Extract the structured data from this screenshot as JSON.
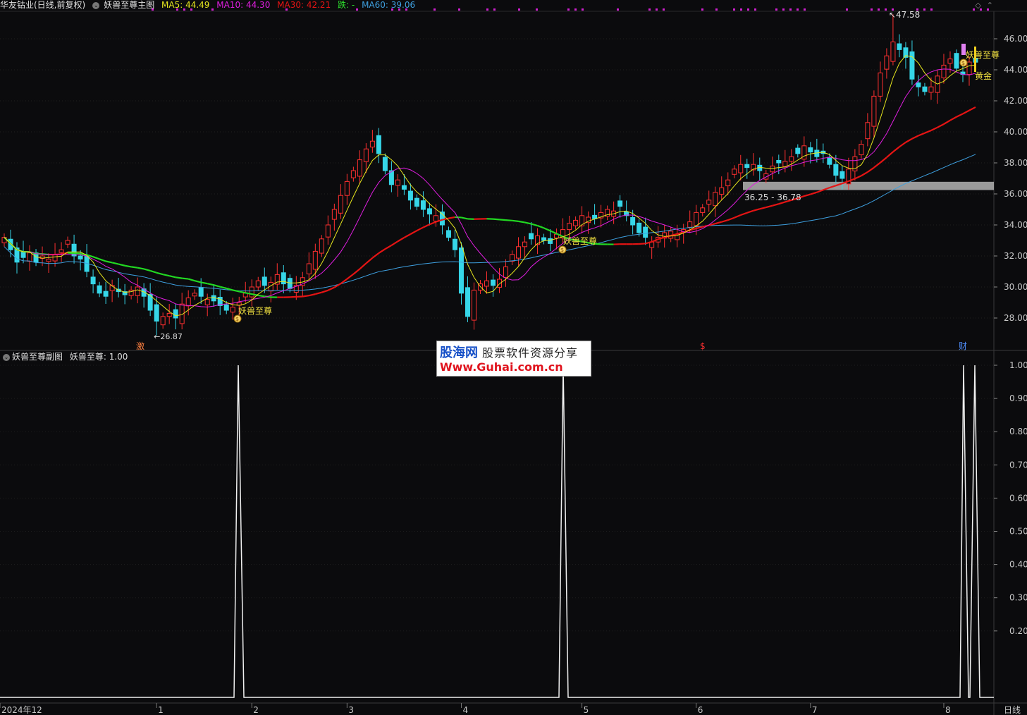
{
  "header": {
    "stock": "华友钴业(日线,前复权)",
    "main_chart": "妖兽至尊主图",
    "ma5": "MA5: 44.49",
    "ma10": "MA10: 44.30",
    "ma30": "MA30: 42.21",
    "die": "跌: -",
    "ma60": "MA60: 39.06"
  },
  "sub_header": {
    "name": "妖兽至尊副图",
    "value": "妖兽至尊: 1.00"
  },
  "colors": {
    "ma5": "#e6e61e",
    "ma10": "#e01ee0",
    "ma30": "#e61414",
    "ma60": "#3ea0e0",
    "up": "#ff3030",
    "down": "#36d6e8",
    "bg": "#0b0b0d"
  },
  "annotations": {
    "high": "47.58",
    "low": "26.87",
    "range": "36.25 - 36.78",
    "signal": "妖兽至尊",
    "gold": "黄金",
    "marker_ji": "激",
    "marker_s": "$",
    "marker_cai": "财"
  },
  "timeframe": "日线",
  "watermark": {
    "line1_a": "股海网",
    "line1_b": "股票软件资源分享",
    "line2": "Www.Guhai.com.cn"
  },
  "chart_data": [
    {
      "type": "candlestick",
      "title": "妖兽至尊主图",
      "ylim": [
        26.0,
        47.8
      ],
      "yticks": [
        "46.00",
        "44.00",
        "42.00",
        "40.00",
        "38.00",
        "36.00",
        "34.00",
        "32.00",
        "30.00",
        "28.00"
      ],
      "ytick_values": [
        46,
        44,
        42,
        40,
        38,
        36,
        34,
        32,
        30,
        28
      ],
      "xticks": [
        "2024年12",
        "1",
        "2",
        "3",
        "4",
        "5",
        "6",
        "7",
        "8"
      ],
      "xtick_index": [
        0,
        24,
        39,
        54,
        72,
        91,
        109,
        127,
        148
      ],
      "closes": [
        33.2,
        32.4,
        31.6,
        31.9,
        32.2,
        31.6,
        32.0,
        31.8,
        32.1,
        32.4,
        33.0,
        32.0,
        31.8,
        31.0,
        30.2,
        29.6,
        29.4,
        30.1,
        29.7,
        29.5,
        29.8,
        30.0,
        29.4,
        28.5,
        27.8,
        28.1,
        28.3,
        28.0,
        28.9,
        29.3,
        29.6,
        29.4,
        29.2,
        29.1,
        28.8,
        28.5,
        28.7,
        29.0,
        29.6,
        30.0,
        30.4,
        30.1,
        30.3,
        30.8,
        30.2,
        29.9,
        30.1,
        30.6,
        31.5,
        32.3,
        33.1,
        34.0,
        35.0,
        35.9,
        36.8,
        37.5,
        38.2,
        38.9,
        39.4,
        38.6,
        37.5,
        36.6,
        36.9,
        36.3,
        35.6,
        35.2,
        35.0,
        34.7,
        34.6,
        34.0,
        33.2,
        32.4,
        29.6,
        28.1,
        29.8,
        30.2,
        30.4,
        30.1,
        30.5,
        31.3,
        32.1,
        32.6,
        32.9,
        33.1,
        33.3,
        33.0,
        32.8,
        33.4,
        33.7,
        34.1,
        34.3,
        34.6,
        34.5,
        34.4,
        34.8,
        35.0,
        34.9,
        35.2,
        34.6,
        34.0,
        33.5,
        33.2,
        32.9,
        33.2,
        33.5,
        33.6,
        33.4,
        33.7,
        34.2,
        34.8,
        35.1,
        35.6,
        36.1,
        36.4,
        36.9,
        37.6,
        37.9,
        37.7,
        37.9,
        37.5,
        37.3,
        37.8,
        38.0,
        38.1,
        38.4,
        38.6,
        39.1,
        38.7,
        38.4,
        38.6,
        37.9,
        37.2,
        37.0,
        37.6,
        38.4,
        39.2,
        40.6,
        42.3,
        43.8,
        44.9,
        45.8,
        45.3,
        44.8,
        43.4,
        42.9,
        42.6,
        42.9,
        43.6,
        44.3,
        44.7,
        44.1,
        43.7,
        44.5,
        44.49
      ],
      "ma5_last": 44.49,
      "ma10_last": 44.3,
      "ma30_last": 42.21,
      "ma60_last": 39.06,
      "range_band": [
        36.25,
        36.78
      ]
    },
    {
      "type": "line",
      "title": "妖兽至尊副图",
      "ylim": [
        0,
        1.0
      ],
      "yticks": [
        "1.00",
        "0.90",
        "0.80",
        "0.70",
        "0.60",
        "0.50",
        "0.40",
        "0.30",
        "0.20"
      ],
      "ytick_values": [
        1.0,
        0.9,
        0.8,
        0.7,
        0.6,
        0.5,
        0.4,
        0.3,
        0.2
      ],
      "signal_index": [
        37,
        88,
        157,
        158,
        160
      ]
    }
  ]
}
